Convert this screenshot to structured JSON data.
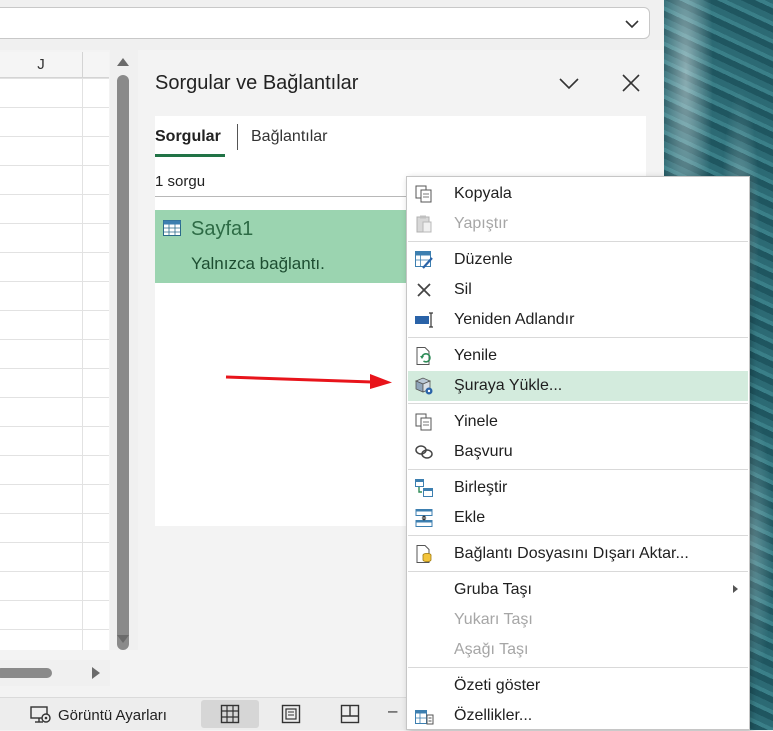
{
  "grid": {
    "column_label": "J"
  },
  "pane": {
    "title": "Sorgular ve Bağlantılar",
    "tabs": {
      "queries": "Sorgular",
      "connections": "Bağlantılar"
    },
    "query_count": "1 sorgu",
    "query": {
      "name": "Sayfa1",
      "description": "Yalnızca bağlantı."
    }
  },
  "status_bar": {
    "display_settings": "Görüntü Ayarları",
    "zoom_minus": "–"
  },
  "context_menu": {
    "items": [
      {
        "label": "Kopyala",
        "icon": "copy-icon",
        "enabled": true
      },
      {
        "label": "Yapıştır",
        "icon": "paste-icon",
        "enabled": false
      },
      {
        "label": "Düzenle",
        "icon": "edit-icon",
        "enabled": true
      },
      {
        "label": "Sil",
        "icon": "delete-icon",
        "enabled": true
      },
      {
        "label": "Yeniden Adlandır",
        "icon": "rename-icon",
        "enabled": true
      },
      {
        "label": "Yenile",
        "icon": "refresh-icon",
        "enabled": true
      },
      {
        "label": "Şuraya Yükle...",
        "icon": "load-to-icon",
        "enabled": true,
        "highlighted": true
      },
      {
        "label": "Yinele",
        "icon": "duplicate-icon",
        "enabled": true
      },
      {
        "label": "Başvuru",
        "icon": "reference-icon",
        "enabled": true
      },
      {
        "label": "Birleştir",
        "icon": "merge-icon",
        "enabled": true
      },
      {
        "label": "Ekle",
        "icon": "append-icon",
        "enabled": true
      },
      {
        "label": "Bağlantı Dosyasını Dışarı Aktar...",
        "icon": "export-connection-icon",
        "enabled": true
      },
      {
        "label": "Gruba Taşı",
        "icon": "",
        "enabled": true,
        "submenu": true
      },
      {
        "label": "Yukarı Taşı",
        "icon": "",
        "enabled": false
      },
      {
        "label": "Aşağı Taşı",
        "icon": "",
        "enabled": false
      },
      {
        "label": "Özeti göster",
        "icon": "",
        "enabled": true
      },
      {
        "label": "Özellikler...",
        "icon": "properties-icon",
        "enabled": true
      }
    ]
  },
  "colors": {
    "accent_green": "#217346",
    "query_highlight": "#9bd4b0",
    "menu_hover": "#d3ebdd",
    "arrow_red": "#e8141b"
  }
}
